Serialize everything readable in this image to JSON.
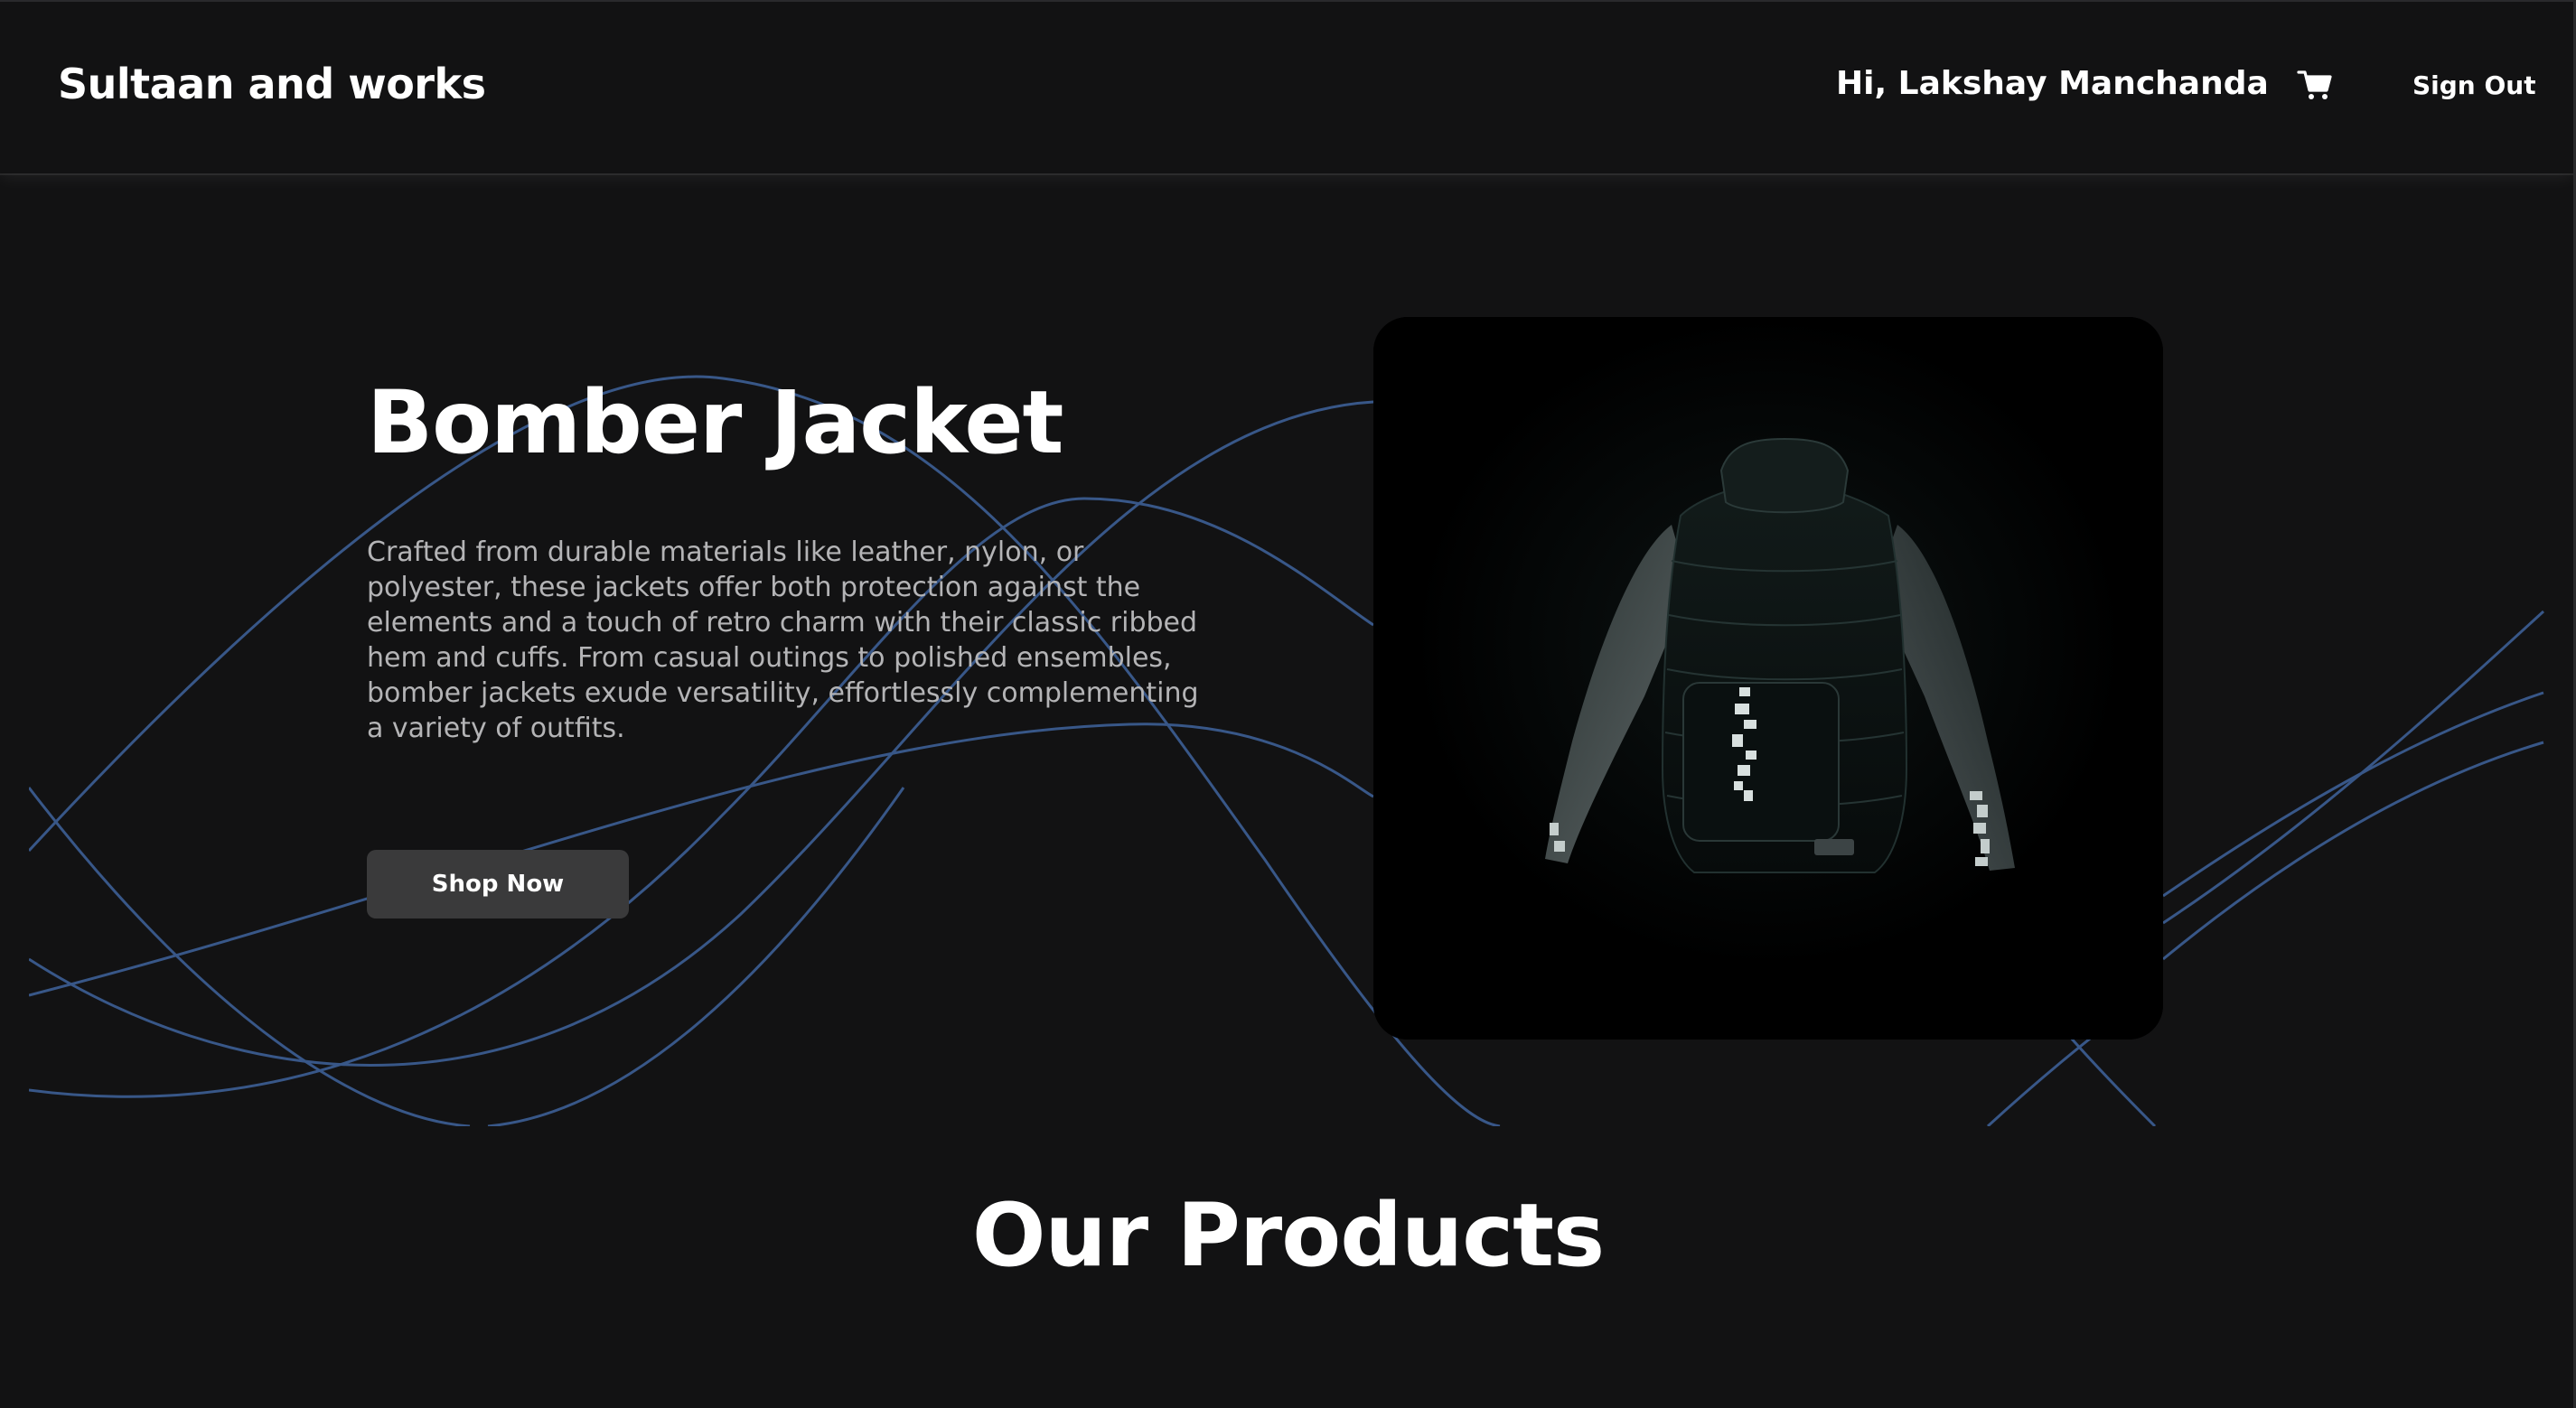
{
  "header": {
    "brand": "Sultaan and works",
    "greeting": "Hi, Lakshay Manchanda",
    "cart_icon": "shopping-cart-icon",
    "sign_out_label": "Sign Out"
  },
  "hero": {
    "title": "Bomber Jacket",
    "description": "Crafted from durable materials like leather, nylon, or polyester, these jackets offer both protection against the elements and a touch of retro charm with their classic ribbed hem and cuffs. From casual outings to polished ensembles, bomber jackets exude versatility, effortlessly complementing a variety of outfits.",
    "cta_label": "Shop Now",
    "image_alt": "black-bomber-jacket-image"
  },
  "products": {
    "heading": "Our Products"
  },
  "colors": {
    "background": "#121213",
    "wave": "#3b5b8f",
    "button_bg": "#3a3a3b",
    "text_muted": "#b4b4b6"
  }
}
